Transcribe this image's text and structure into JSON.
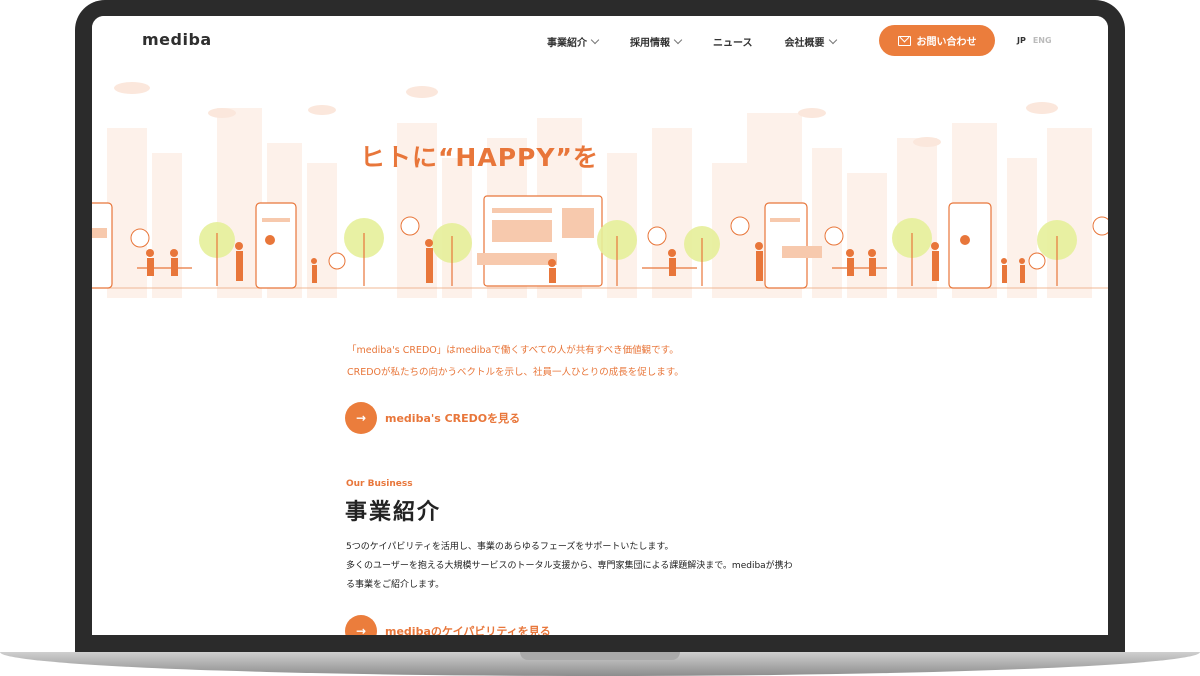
{
  "header": {
    "logo": "mediba",
    "nav": [
      {
        "label": "事業紹介",
        "has_dropdown": true
      },
      {
        "label": "採用情報",
        "has_dropdown": true
      },
      {
        "label": "ニュース",
        "has_dropdown": false
      },
      {
        "label": "会社概要",
        "has_dropdown": true
      }
    ],
    "contact_label": "お問い合わせ",
    "lang_jp": "JP",
    "lang_en": "ENG"
  },
  "hero": {
    "title": "ヒトに“HAPPY”を"
  },
  "credo": {
    "line1": "「mediba's CREDO」はmedibaで働くすべての人が共有すべき価値観です。",
    "line2": "CREDOが私たちの向かうベクトルを示し、社員一人ひとりの成長を促します。",
    "cta_label": "mediba's CREDOを見る",
    "cta_arrow": "→"
  },
  "business": {
    "eyebrow": "Our Business",
    "title": "事業紹介",
    "body_line1": "5つのケイパビリティを活用し、事業のあらゆるフェーズをサポートいたします。",
    "body_line2": "多くのユーザーを抱える大規模サービスのトータル支援から、専門家集団による課題解決まで。medibaが携わ",
    "body_line3": "る事業をご紹介します。",
    "cta_label": "medibaのケイパビリティを見る",
    "cta_arrow": "→"
  },
  "colors": {
    "accent": "#eb7d3c",
    "bezel": "#2b2b2b",
    "illustration_light": "#fbe5d8",
    "tree_green": "#dbe98a"
  }
}
